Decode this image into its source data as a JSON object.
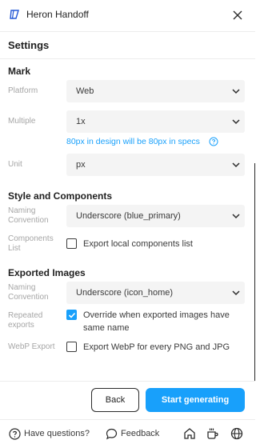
{
  "window": {
    "title": "Heron Handoff"
  },
  "header": {
    "title": "Settings"
  },
  "mark": {
    "title": "Mark",
    "platform": {
      "label": "Platform",
      "value": "Web"
    },
    "multiple": {
      "label": "Multiple",
      "value": "1x",
      "hint": "80px in design will be 80px in specs"
    },
    "unit": {
      "label": "Unit",
      "value": "px"
    }
  },
  "style_components": {
    "title": "Style and Components",
    "naming": {
      "label_line1": "Naming",
      "label_line2": "Convention",
      "value": "Underscore (blue_primary)"
    },
    "components_list": {
      "label_line1": "Components",
      "label_line2": "List",
      "checkbox_label": "Export local components list",
      "checked": false
    }
  },
  "exported_images": {
    "title": "Exported Images",
    "naming": {
      "label_line1": "Naming",
      "label_line2": "Convention",
      "value": "Underscore (icon_home)"
    },
    "repeated": {
      "label_line1": "Repeated",
      "label_line2": "exports",
      "checkbox_line1": "Override when exported images have",
      "checkbox_line2": "same name",
      "checked": true
    },
    "webp": {
      "label": "WebP Export",
      "checkbox_label": "Export WebP for every PNG and JPG",
      "checked": false
    }
  },
  "actions": {
    "back_label": "Back",
    "generate_label": "Start generating"
  },
  "footer": {
    "questions_label": "Have questions?",
    "feedback_label": "Feedback"
  },
  "colors": {
    "accent": "#18a0fb"
  }
}
